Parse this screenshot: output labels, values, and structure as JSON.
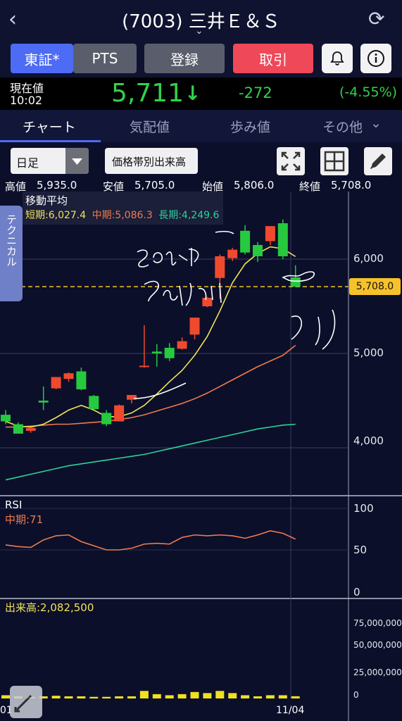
{
  "header": {
    "back_icon": "chevron-left-icon",
    "title": "(7003) 三井Ｅ＆Ｓ",
    "refresh_icon": "refresh-icon"
  },
  "buttons": {
    "market_tse": "東証*",
    "market_pts": "PTS",
    "register": "登録",
    "trade": "取引",
    "bell_icon": "bell-icon",
    "info_icon": "info-icon"
  },
  "price": {
    "label": "現在値",
    "time": "10:02",
    "value": "5,711",
    "arrow": "↓",
    "change": "-272",
    "change_pct": "(-4.55%)"
  },
  "tabs": [
    {
      "label": "チャート",
      "active": true
    },
    {
      "label": "気配値"
    },
    {
      "label": "歩み値"
    },
    {
      "label": "その他"
    }
  ],
  "controls": {
    "period": "日足",
    "price_band_button": "価格帯別出来高"
  },
  "ohlc": {
    "high_label": "高値",
    "high": "5,935.0",
    "low_label": "安値",
    "low": "5,705.0",
    "open_label": "始値",
    "open": "5,806.0",
    "close_label": "終値",
    "close": "5,708.0"
  },
  "side_tab": "テクニカル",
  "ma": {
    "title": "移動平均",
    "short": "短期:6,027.4",
    "mid": "中期:5,086.3",
    "long": "長期:4,249.6"
  },
  "rsi": {
    "title": "RSI",
    "mid": "中期:71"
  },
  "volume": {
    "title": "出来高:2,082,500"
  },
  "axis": {
    "price_ticks": [
      "6,000",
      "5,000",
      "4,000"
    ],
    "price_marker": "5,708.0",
    "rsi_ticks": [
      "100",
      "50",
      "0"
    ],
    "volume_ticks": [
      "75,000,000",
      "50,000,000",
      "25,000,000",
      "0"
    ],
    "x_labels": [
      "01",
      "11/04"
    ]
  },
  "handwriting": {
    "line1": "このへんで",
    "line2": "でいかり",
    "right": "うり"
  },
  "colors": {
    "up": "#ef4a2e",
    "down": "#27c93f",
    "ma_short": "#f0e25a",
    "ma_mid": "#f07a4c",
    "ma_long": "#2fd19a",
    "marker": "#f6c12b"
  },
  "chart_data": {
    "type": "candlestick",
    "candles": [
      {
        "o": 4350,
        "h": 4400,
        "l": 4250,
        "c": 4280
      },
      {
        "o": 4250,
        "h": 4270,
        "l": 4150,
        "c": 4150
      },
      {
        "o": 4180,
        "h": 4210,
        "l": 4160,
        "c": 4210
      },
      {
        "o": 4500,
        "h": 4650,
        "l": 4400,
        "c": 4480
      },
      {
        "o": 4630,
        "h": 4750,
        "l": 4620,
        "c": 4750
      },
      {
        "o": 4730,
        "h": 4800,
        "l": 4700,
        "c": 4790
      },
      {
        "o": 4810,
        "h": 4850,
        "l": 4610,
        "c": 4620
      },
      {
        "o": 4550,
        "h": 4560,
        "l": 4410,
        "c": 4410
      },
      {
        "o": 4370,
        "h": 4400,
        "l": 4230,
        "c": 4250
      },
      {
        "o": 4280,
        "h": 4460,
        "l": 4280,
        "c": 4450
      },
      {
        "o": 4510,
        "h": 4560,
        "l": 4470,
        "c": 4560
      },
      {
        "o": 4870,
        "h": 5300,
        "l": 4850,
        "c": 4870
      },
      {
        "o": 5020,
        "h": 5100,
        "l": 4860,
        "c": 5000
      },
      {
        "o": 5060,
        "h": 5110,
        "l": 4920,
        "c": 4950
      },
      {
        "o": 5050,
        "h": 5170,
        "l": 5040,
        "c": 5130
      },
      {
        "o": 5200,
        "h": 5380,
        "l": 5150,
        "c": 5380
      },
      {
        "o": 5500,
        "h": 5600,
        "l": 5490,
        "c": 5590
      },
      {
        "o": 5800,
        "h": 6050,
        "l": 5580,
        "c": 6030
      },
      {
        "o": 6010,
        "h": 6120,
        "l": 5980,
        "c": 6100
      },
      {
        "o": 6300,
        "h": 6360,
        "l": 6050,
        "c": 6070
      },
      {
        "o": 6150,
        "h": 6180,
        "l": 5970,
        "c": 6030
      },
      {
        "o": 6190,
        "h": 6350,
        "l": 6150,
        "c": 6350
      },
      {
        "o": 6380,
        "h": 6420,
        "l": 6000,
        "c": 6030
      },
      {
        "o": 5806,
        "h": 5935,
        "l": 5705,
        "c": 5708
      }
    ],
    "ma_short": [
      4280,
      4230,
      4220,
      4250,
      4320,
      4400,
      4450,
      4400,
      4330,
      4330,
      4370,
      4450,
      4570,
      4700,
      4820,
      4980,
      5180,
      5450,
      5750,
      5950,
      6060,
      6130,
      6110,
      6027
    ],
    "ma_mid": [
      4220,
      4220,
      4230,
      4240,
      4250,
      4250,
      4260,
      4270,
      4280,
      4300,
      4320,
      4350,
      4390,
      4430,
      4470,
      4520,
      4580,
      4650,
      4720,
      4790,
      4860,
      4920,
      4980,
      5086
    ],
    "ma_long": [
      3660,
      3690,
      3720,
      3750,
      3780,
      3810,
      3830,
      3850,
      3870,
      3890,
      3910,
      3930,
      3960,
      3990,
      4020,
      4050,
      4080,
      4110,
      4140,
      4170,
      4200,
      4220,
      4240,
      4250
    ],
    "rsi": [
      56,
      54,
      53,
      62,
      67,
      68,
      60,
      55,
      50,
      50,
      52,
      57,
      58,
      57,
      65,
      68,
      67,
      68,
      67,
      64,
      68,
      73,
      70,
      63
    ],
    "volume": [
      3000000,
      2000000,
      1500000,
      2000000,
      2500000,
      2000000,
      2000000,
      1500000,
      1500000,
      2000000,
      2000000,
      7000000,
      4000000,
      3000000,
      4000000,
      6000000,
      5000000,
      7000000,
      5000000,
      3000000,
      2000000,
      3000000,
      3000000,
      2082500
    ],
    "price_range": [
      3500,
      6600
    ],
    "rsi_range": [
      0,
      100
    ],
    "volume_range": [
      0,
      85000000
    ]
  }
}
